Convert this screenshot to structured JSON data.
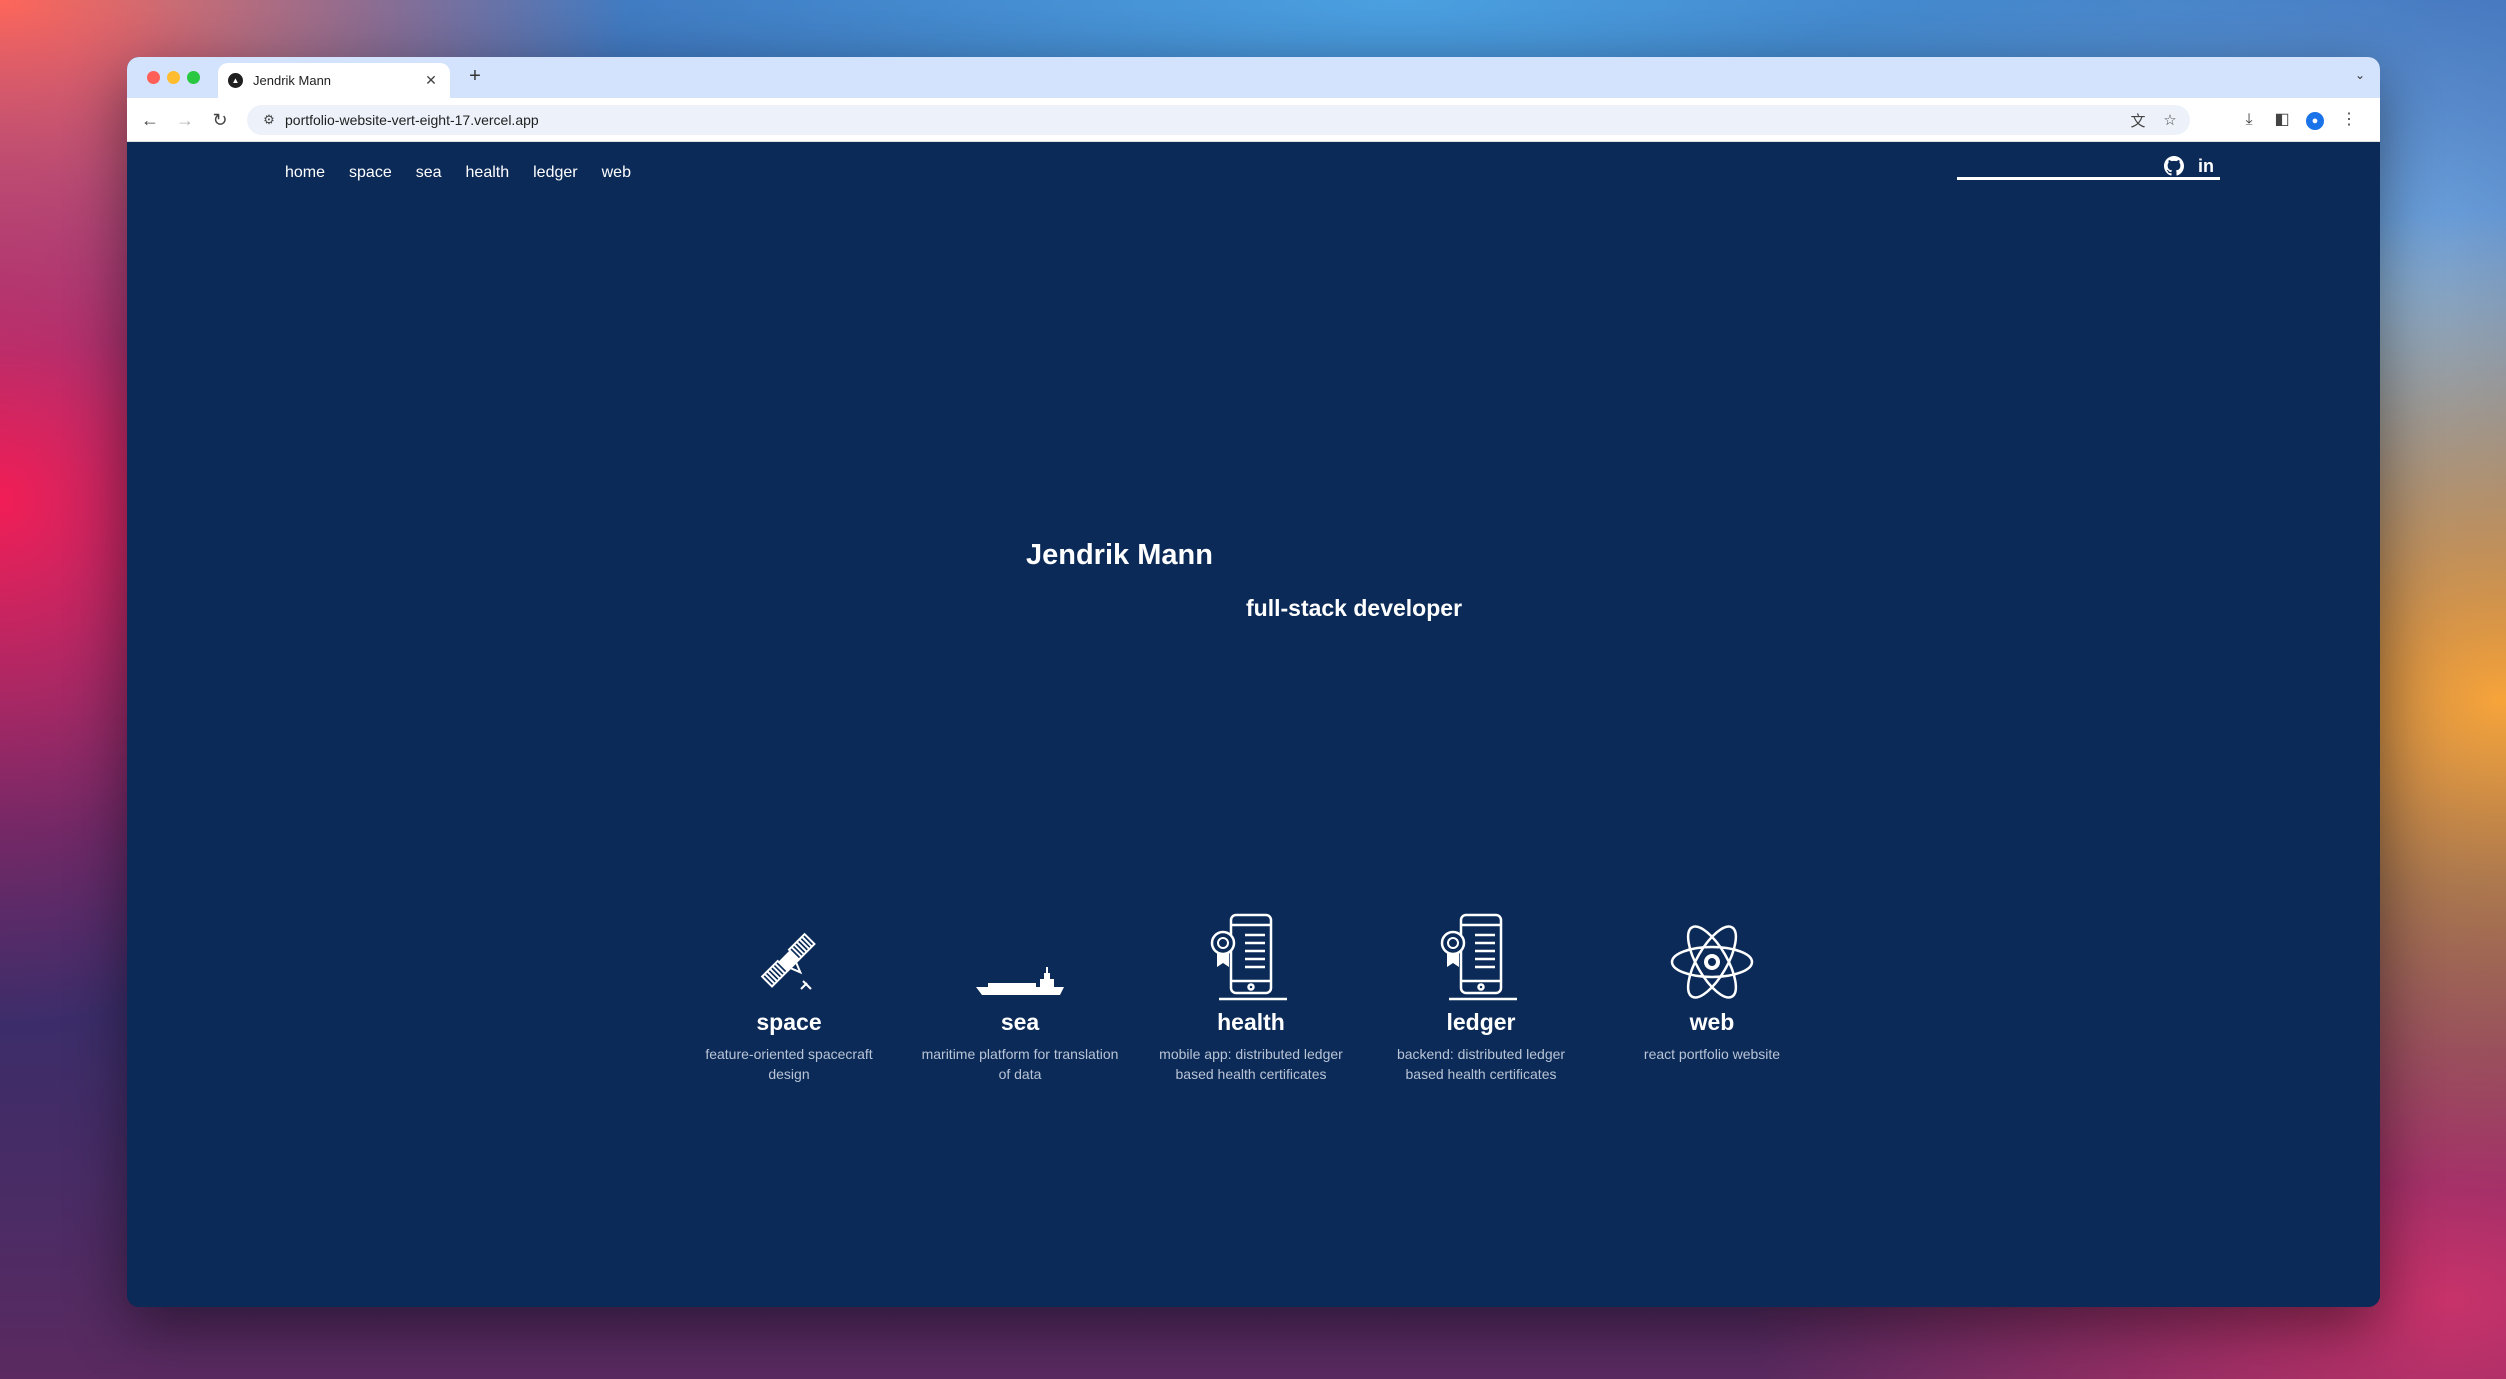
{
  "browser": {
    "tab_title": "Jendrik Mann",
    "url": "portfolio-website-vert-eight-17.vercel.app"
  },
  "nav": {
    "items": [
      "home",
      "space",
      "sea",
      "health",
      "ledger",
      "web"
    ]
  },
  "social": {
    "github_icon": "github-icon",
    "linkedin_icon": "linkedin-icon"
  },
  "hero": {
    "name": "Jendrik Mann",
    "role": "full-stack developer"
  },
  "projects": [
    {
      "title": "space",
      "icon": "satellite-icon",
      "description": "feature-oriented spacecraft design"
    },
    {
      "title": "sea",
      "icon": "ship-icon",
      "description": "maritime platform for translation of data"
    },
    {
      "title": "health",
      "icon": "phone-certificate-icon",
      "description": "mobile app: distributed ledger based health certificates"
    },
    {
      "title": "ledger",
      "icon": "phone-certificate-icon",
      "description": "backend: distributed ledger based health certificates"
    },
    {
      "title": "web",
      "icon": "react-atom-icon",
      "description": "react portfolio website"
    }
  ],
  "colors": {
    "page_background": "#0b2a57",
    "text": "#ffffff",
    "description_text": "#b9c4d6",
    "tabstrip": "#d3e3fd"
  }
}
